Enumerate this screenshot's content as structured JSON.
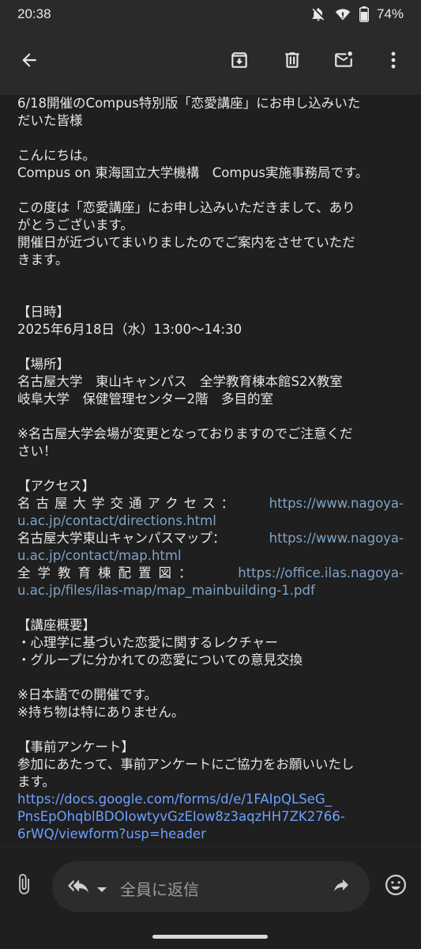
{
  "status_bar": {
    "time": "20:38",
    "battery_percent": "74%",
    "icons": [
      "bell-off-icon",
      "wifi-icon",
      "battery-icon"
    ]
  },
  "toolbar": {
    "icons": [
      "back-arrow-icon",
      "archive-icon",
      "delete-icon",
      "mark-unread-icon",
      "more-vert-icon"
    ]
  },
  "email": {
    "lines": [
      "6/18開催のCompus特別版「恋愛講座」にお申し込みいた",
      "だいた皆様",
      "",
      "こんにちは。",
      "Compus on 東海国立大学機構　Compus実施事務局です。",
      "",
      "この度は「恋愛講座」にお申し込みいただきまして、あり",
      "がとうございます。",
      "開催日が近づいてまいりましたのでご案内をさせていただ",
      "きます。",
      "",
      "",
      "【日時】",
      "2025年6月18日（水）13:00〜14:30",
      "",
      "【場所】",
      "名古屋大学　東山キャンパス　全学教育棟本館S2X教室",
      "岐阜大学　保健管理センター2階　多目的室",
      "",
      "※名古屋大学会場が変更となっておりますのでご注意くだ",
      "さい！",
      "",
      "【アクセス】"
    ],
    "access": [
      {
        "label": "名古屋大学交通アクセス：",
        "url_1": "https://www.nagoya-",
        "url_2": "u.ac.jp/contact/directions.html"
      },
      {
        "label": "名古屋大学東山キャンパスマップ：",
        "url_1": "https://www.nagoya-",
        "url_2": "u.ac.jp/contact/map.html"
      },
      {
        "label": "全学教育棟配置図：",
        "url_1": "https://office.ilas.nagoya-",
        "url_2": "u.ac.jp/files/ilas-map/map_mainbuilding-1.pdf"
      }
    ],
    "lines_after": [
      "",
      "【講座概要】",
      "・心理学に基づいた恋愛に関するレクチャー",
      "・グループに分かれての恋愛についての意見交換",
      "",
      "※日本語での開催です。",
      "※持ち物は特にありません。",
      "",
      "【事前アンケート】",
      "参加にあたって、事前アンケートにご協力をお願いいたし",
      "ます。"
    ],
    "survey_link": [
      "https://docs.google.com/forms/d/e/1FAIpQLSeG_",
      "PnsEpOhqblBDOIowtyvGzEIow8z3aqzHH7ZK2766-",
      "6rWQ/viewform?usp=header"
    ]
  },
  "bottom_bar": {
    "reply_placeholder": "全員に返信",
    "icons": [
      "attach-icon",
      "reply-all-icon",
      "dropdown-icon",
      "forward-icon",
      "emoji-icon"
    ]
  }
}
